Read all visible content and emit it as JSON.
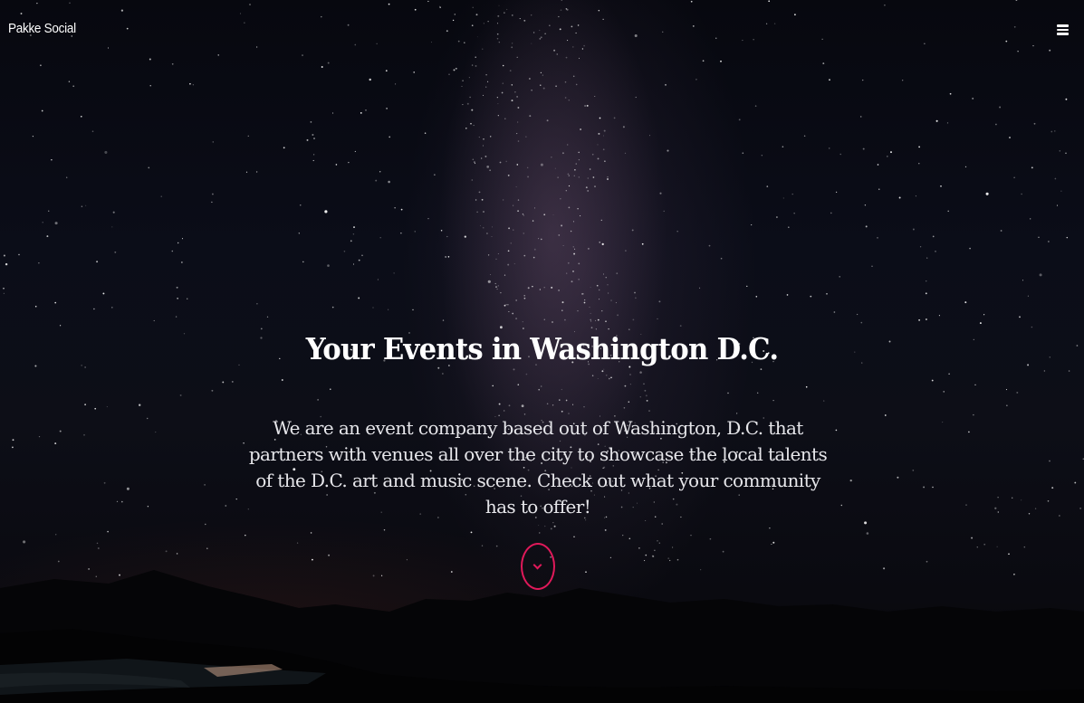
{
  "navbar": {
    "brand": "Pakke Social",
    "menu_icon": "hamburger-menu-icon"
  },
  "hero": {
    "headline": "Your Events in Washington D.C.",
    "description": "We are an event company based out of Washington, D.C. that partners with venues all over the city to showcase the local talents of the D.C. art and music scene. Check out what your community has to offer!",
    "scroll_icon": "chevron-down-icon",
    "background": "night-sky-milky-way-image"
  },
  "colors": {
    "accent": "#e0195a",
    "text": "#ffffff",
    "background": "#07080f"
  }
}
